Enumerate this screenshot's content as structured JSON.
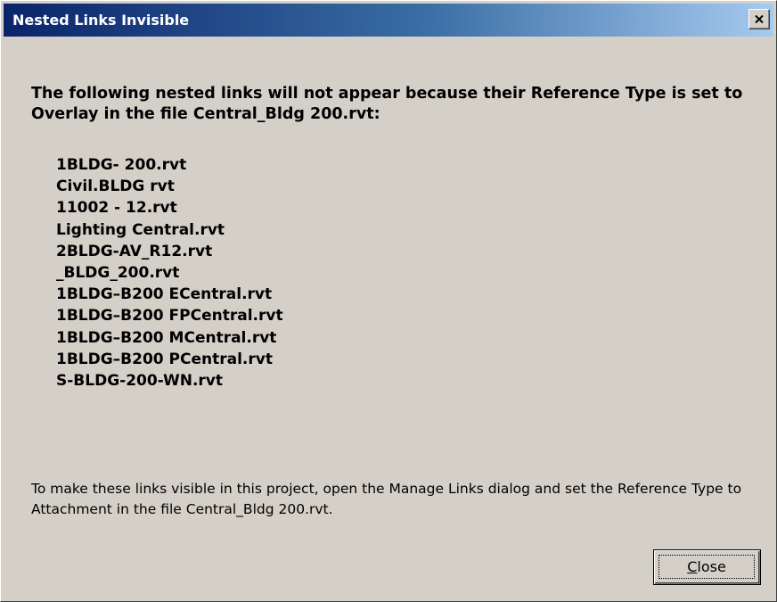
{
  "window": {
    "title": "Nested Links Invisible",
    "close_icon": "close-x-icon"
  },
  "message": "The following nested links will not appear because their Reference Type is set to Overlay in the file Central_Bldg 200.rvt:",
  "files": [
    "1BLDG- 200.rvt",
    "Civil.BLDG rvt",
    "11002 - 12.rvt",
    "Lighting Central.rvt",
    "2BLDG-AV_R12.rvt",
    "_BLDG_200.rvt",
    "1BLDG–B200 ECentral.rvt",
    "1BLDG–B200 FPCentral.rvt",
    "1BLDG–B200 MCentral.rvt",
    "1BLDG–B200 PCentral.rvt",
    "S-BLDG-200-WN.rvt"
  ],
  "instruction": "To make these links visible in this project, open the Manage Links dialog and set the Reference Type to Attachment in the file Central_Bldg 200.rvt.",
  "buttons": {
    "close_mnemonic": "C",
    "close_rest": "lose"
  },
  "colors": {
    "face": "#d4d0c8",
    "title_start": "#0a246a",
    "title_end": "#a6caf0"
  }
}
